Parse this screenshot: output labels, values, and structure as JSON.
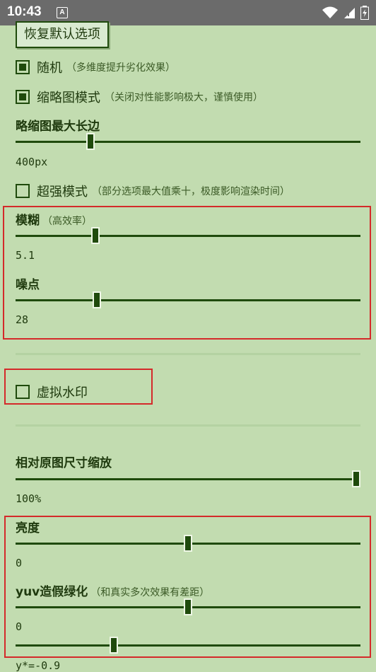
{
  "statusbar": {
    "time": "10:43",
    "notif_letter": "A"
  },
  "reset_button": "恢复默认选项",
  "random": {
    "label": "随机",
    "note": "（多维度提升劣化效果）",
    "checked": true
  },
  "thumbnail_mode": {
    "label": "缩略图模式",
    "note": "（关闭对性能影响极大，谨慎使用）",
    "checked": true
  },
  "thumb_max_edge": {
    "label": "略缩图最大长边",
    "value": "400px",
    "fraction": 0.21
  },
  "super_mode": {
    "label": "超强模式",
    "note": "（部分选项最大值乘十，极度影响渲染时间）",
    "checked": false
  },
  "blur": {
    "label": "模糊",
    "note": "（高效率）",
    "value": "5.1",
    "fraction": 0.225
  },
  "noise": {
    "label": "噪点",
    "value": "28",
    "fraction": 0.228
  },
  "watermark": {
    "label": "虚拟水印",
    "checked": false
  },
  "scale": {
    "label": "相对原图尺寸缩放",
    "value": "100%",
    "fraction": 1.0
  },
  "brightness": {
    "label": "亮度",
    "value": "0",
    "fraction": 0.5
  },
  "yuv_green": {
    "label": "yuv造假绿化",
    "note": "（和真实多次效果有差距）",
    "value": "0",
    "fraction": 0.5
  },
  "yuv_factor": {
    "value": "y*=-0.9",
    "fraction": 0.28
  }
}
